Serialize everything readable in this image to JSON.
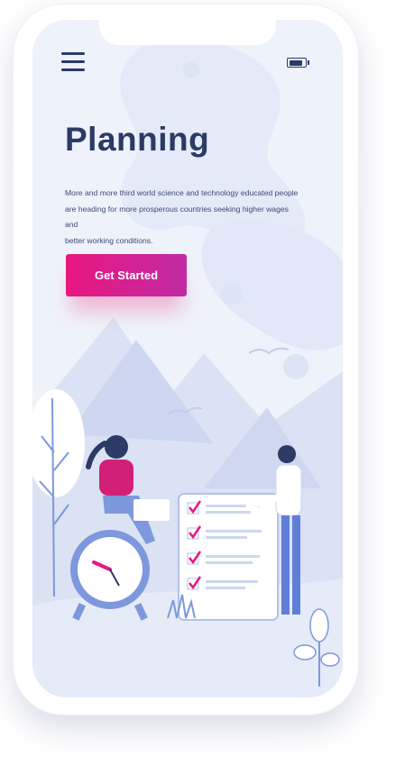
{
  "status_bar": {
    "menu_icon": "hamburger-menu-icon",
    "battery_icon": "battery-icon"
  },
  "main": {
    "title": "Planning",
    "description_lines": [
      "More and more third world science and technology educated people",
      "are heading for more prosperous countries seeking higher wages and",
      "better working conditions."
    ],
    "cta_label": "Get Started"
  },
  "illustration": {
    "checklist_items": 4,
    "icons": [
      "clock-icon",
      "checkmark-icon",
      "mountain-icon",
      "tree-icon",
      "bird-icon"
    ]
  },
  "colors": {
    "accent_start": "#e9177f",
    "accent_end": "#c12aa5",
    "title": "#2c3a66",
    "screen_bg": "#eef2fb",
    "illustration_blue": "#c7d3ee"
  }
}
